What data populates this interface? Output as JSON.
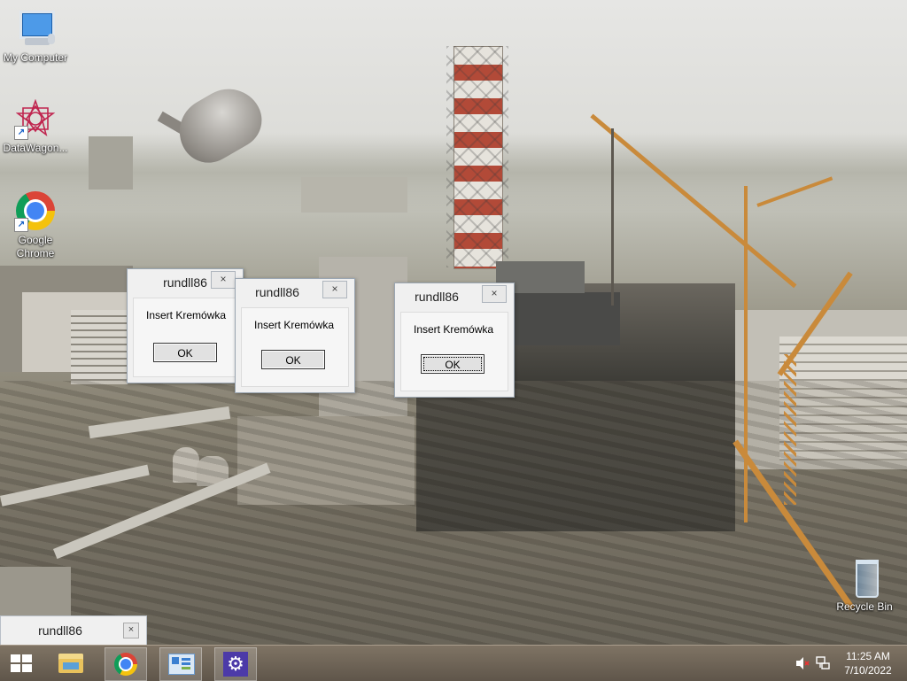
{
  "desktop": {
    "icons": [
      {
        "label": "My Computer"
      },
      {
        "label": "DataWagon..."
      },
      {
        "label": "Google Chrome"
      },
      {
        "label": "Recycle Bin"
      }
    ]
  },
  "dialogs": [
    {
      "title": "rundll86",
      "message": "Insert Kremówka",
      "button": "OK",
      "close": "×"
    },
    {
      "title": "rundll86",
      "message": "Insert Kremówka",
      "button": "OK",
      "close": "×"
    },
    {
      "title": "rundll86",
      "message": "Insert Kremówka",
      "button": "OK",
      "close": "×"
    }
  ],
  "minimized_window": {
    "title": "rundll86",
    "close": "×"
  },
  "taskbar": {
    "apps": [
      {
        "icon": "windows-start-icon"
      },
      {
        "icon": "file-explorer-icon"
      },
      {
        "icon": "google-chrome-icon"
      },
      {
        "icon": "control-panel-icon"
      },
      {
        "icon": "settings-gear-icon"
      }
    ],
    "clock": {
      "time": "11:25 AM",
      "date": "7/10/2022"
    }
  },
  "colors": {
    "taskbar": "#5a5044",
    "dialog_bg": "#f0f0f0",
    "settings_tile": "#4c3aa8"
  }
}
